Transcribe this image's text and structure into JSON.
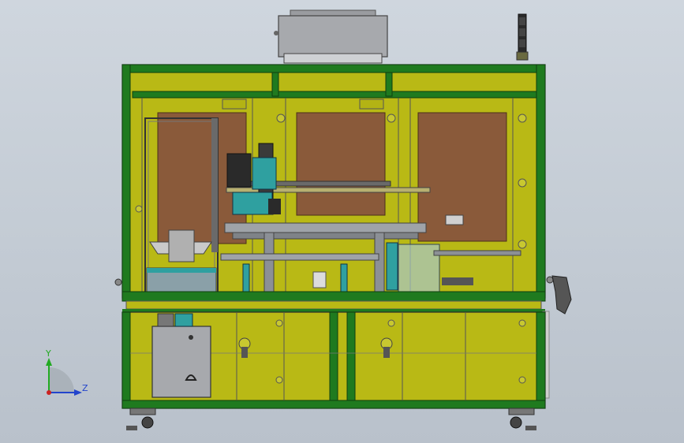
{
  "viewport": {
    "background_top": "#cfd6de",
    "background_bottom": "#b9c1cb"
  },
  "colors": {
    "frame_green": "#1f7a1f",
    "panel_yellow": "#b9b915",
    "panel_yellow_dark": "#9c9c0e",
    "copper_plate": "#8a5a3a",
    "steel_gray": "#8c9096",
    "teal_part": "#2fa0a0",
    "enclosure_gray": "#a7a9ad",
    "x_axis": "#cc2222",
    "y_axis": "#22aa22",
    "z_axis": "#2244cc"
  },
  "triad": {
    "y_label": "Y",
    "z_label": "Z"
  },
  "icons": {
    "orientation": "orientation-triad-icon"
  }
}
